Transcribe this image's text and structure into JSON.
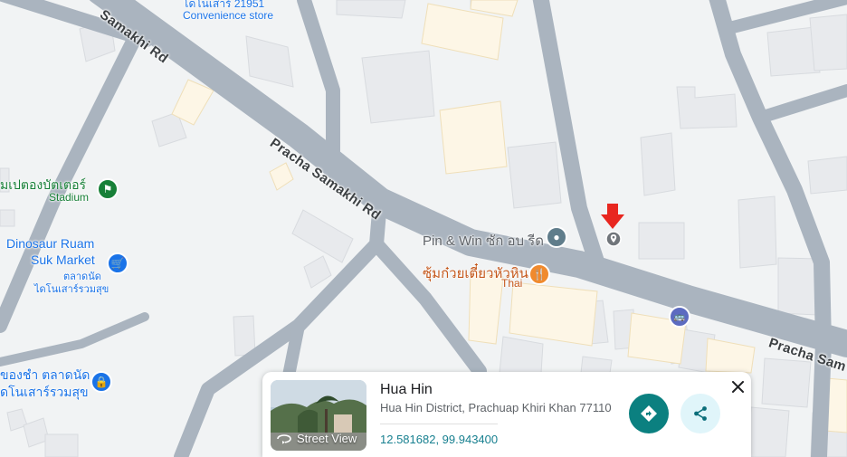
{
  "map": {
    "roads": [
      {
        "name": "Samakhi Rd"
      },
      {
        "name": "Pracha Samakhi Rd"
      },
      {
        "name": "Pracha Sam"
      }
    ],
    "pois": {
      "convenience_store": "โดโนเสาร์ 21951\nConvenience store",
      "stadium_th": "มเปตองบัตเตอร์",
      "stadium_en": "Stadium",
      "market_line1": "Dinosaur Ruam",
      "market_line2": "Suk Market",
      "market_th1": "ตลาดนัด",
      "market_th2": "ไดโนเสาร์รวมสุข",
      "pin_win": "Pin & Win ซัก อบ รีด",
      "restaurant_th": "ซุ้มก๋วยเตี๋ยวหัวหิน",
      "restaurant_type": "Thai",
      "bottom_left_th1": "ของชำ ตลาดนัด",
      "bottom_left_th2": "ดโนเสาร์รวมสุข"
    },
    "colors": {
      "road": "#aab4bf",
      "building": "#e8eaed",
      "building_edge": "#d5d8dc",
      "tan_building": "#fdf5e4",
      "tan_edge": "#f0e0bd",
      "marker": "#e8261f"
    }
  },
  "card": {
    "title": "Hua Hin",
    "address": "Hua Hin District, Prachuap Khiri Khan 77110",
    "coordinates": "12.581682, 99.943400",
    "street_view_label": "Street View",
    "icons": {
      "directions": "directions-icon",
      "share": "share-icon",
      "close": "close-icon"
    }
  }
}
